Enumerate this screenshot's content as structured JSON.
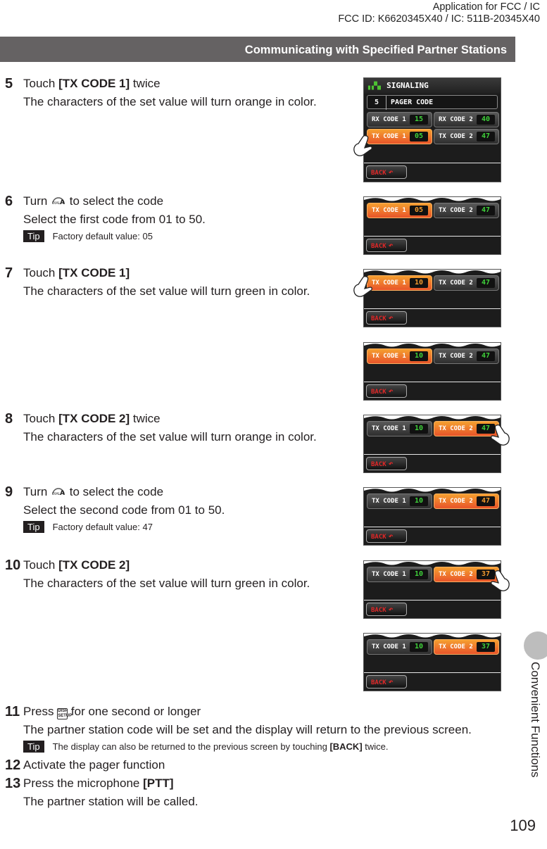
{
  "header": {
    "fcc_line1": "Application for FCC / IC",
    "fcc_line2": "FCC ID: K6620345X40 / IC: 511B-20345X40"
  },
  "section_title": "Communicating with Specified Partner Stations",
  "steps": [
    {
      "num": "5",
      "pre": "Touch ",
      "bold": "[TX CODE 1]",
      "post": " twice",
      "body": "The characters of the set value will turn orange in color."
    },
    {
      "num": "6",
      "pre": "Turn ",
      "icon": "dial-a-icon",
      "post": " to select the code",
      "body": "Select the first code from 01 to 50.",
      "tip_label": "Tip",
      "tip": "Factory default value: 05"
    },
    {
      "num": "7",
      "pre": "Touch ",
      "bold": "[TX CODE 1]",
      "post": "",
      "body": "The characters of the set value will turn green in color."
    },
    {
      "num": "8",
      "pre": "Touch ",
      "bold": "[TX CODE 2]",
      "post": " twice",
      "body": "The characters of the set value will turn orange in color."
    },
    {
      "num": "9",
      "pre": "Turn ",
      "icon": "dial-a-icon",
      "post": " to select the code",
      "body": "Select the second code from 01 to 50.",
      "tip_label": "Tip",
      "tip": "Factory default value: 47"
    },
    {
      "num": "10",
      "pre": "Touch ",
      "bold": "[TX CODE 2]",
      "post": "",
      "body": "The characters of the set value will turn green in color."
    },
    {
      "num": "11",
      "pre": "Press ",
      "icon": "disp-key-icon",
      "post": " for one second or longer",
      "body": "The partner station code will be set and the display will return to the previous screen.",
      "tip_label": "Tip",
      "tip_pre": "The display can also be returned to the previous screen by touching ",
      "tip_bold": "[BACK]",
      "tip_post": " twice."
    },
    {
      "num": "12",
      "pre": "Activate the pager function"
    },
    {
      "num": "13",
      "pre": "Press the microphone ",
      "bold": "[PTT]",
      "body": "The partner station will be called."
    }
  ],
  "screen_full": {
    "title": "SIGNALING",
    "menu_num": "5",
    "menu_label": "PAGER CODE",
    "rx1_label": "RX CODE 1",
    "rx1_value": "15",
    "rx2_label": "RX CODE 2",
    "rx2_value": "40",
    "tx1_label": "TX CODE 1",
    "tx1_value": "05",
    "tx2_label": "TX CODE 2",
    "tx2_value": "47",
    "back_label": "BACK"
  },
  "screens": [
    {
      "tx1_value": "05",
      "tx1_color": "orange",
      "tx1_active": true,
      "tx2_value": "47",
      "tx2_color": "green",
      "tx2_active": false,
      "hand": "none"
    },
    {
      "tx1_value": "10",
      "tx1_color": "orange",
      "tx1_active": true,
      "tx2_value": "47",
      "tx2_color": "green",
      "tx2_active": false,
      "hand": "left"
    },
    {
      "tx1_value": "10",
      "tx1_color": "green",
      "tx1_active": true,
      "tx2_value": "47",
      "tx2_color": "green",
      "tx2_active": false,
      "hand": "none"
    },
    {
      "tx1_value": "10",
      "tx1_color": "green",
      "tx1_active": false,
      "tx2_value": "47",
      "tx2_color": "green",
      "tx2_active": true,
      "hand": "right"
    },
    {
      "tx1_value": "10",
      "tx1_color": "green",
      "tx1_active": false,
      "tx2_value": "47",
      "tx2_color": "orange",
      "tx2_active": true,
      "hand": "none"
    },
    {
      "tx1_value": "10",
      "tx1_color": "green",
      "tx1_active": false,
      "tx2_value": "37",
      "tx2_color": "orange",
      "tx2_active": true,
      "hand": "right"
    },
    {
      "tx1_value": "10",
      "tx1_color": "green",
      "tx1_active": false,
      "tx2_value": "37",
      "tx2_color": "green",
      "tx2_active": true,
      "hand": "none"
    }
  ],
  "labels": {
    "tx1": "TX CODE 1",
    "tx2": "TX CODE 2",
    "back": "BACK"
  },
  "side_tab": "Convenient Functions",
  "page_number": "109"
}
